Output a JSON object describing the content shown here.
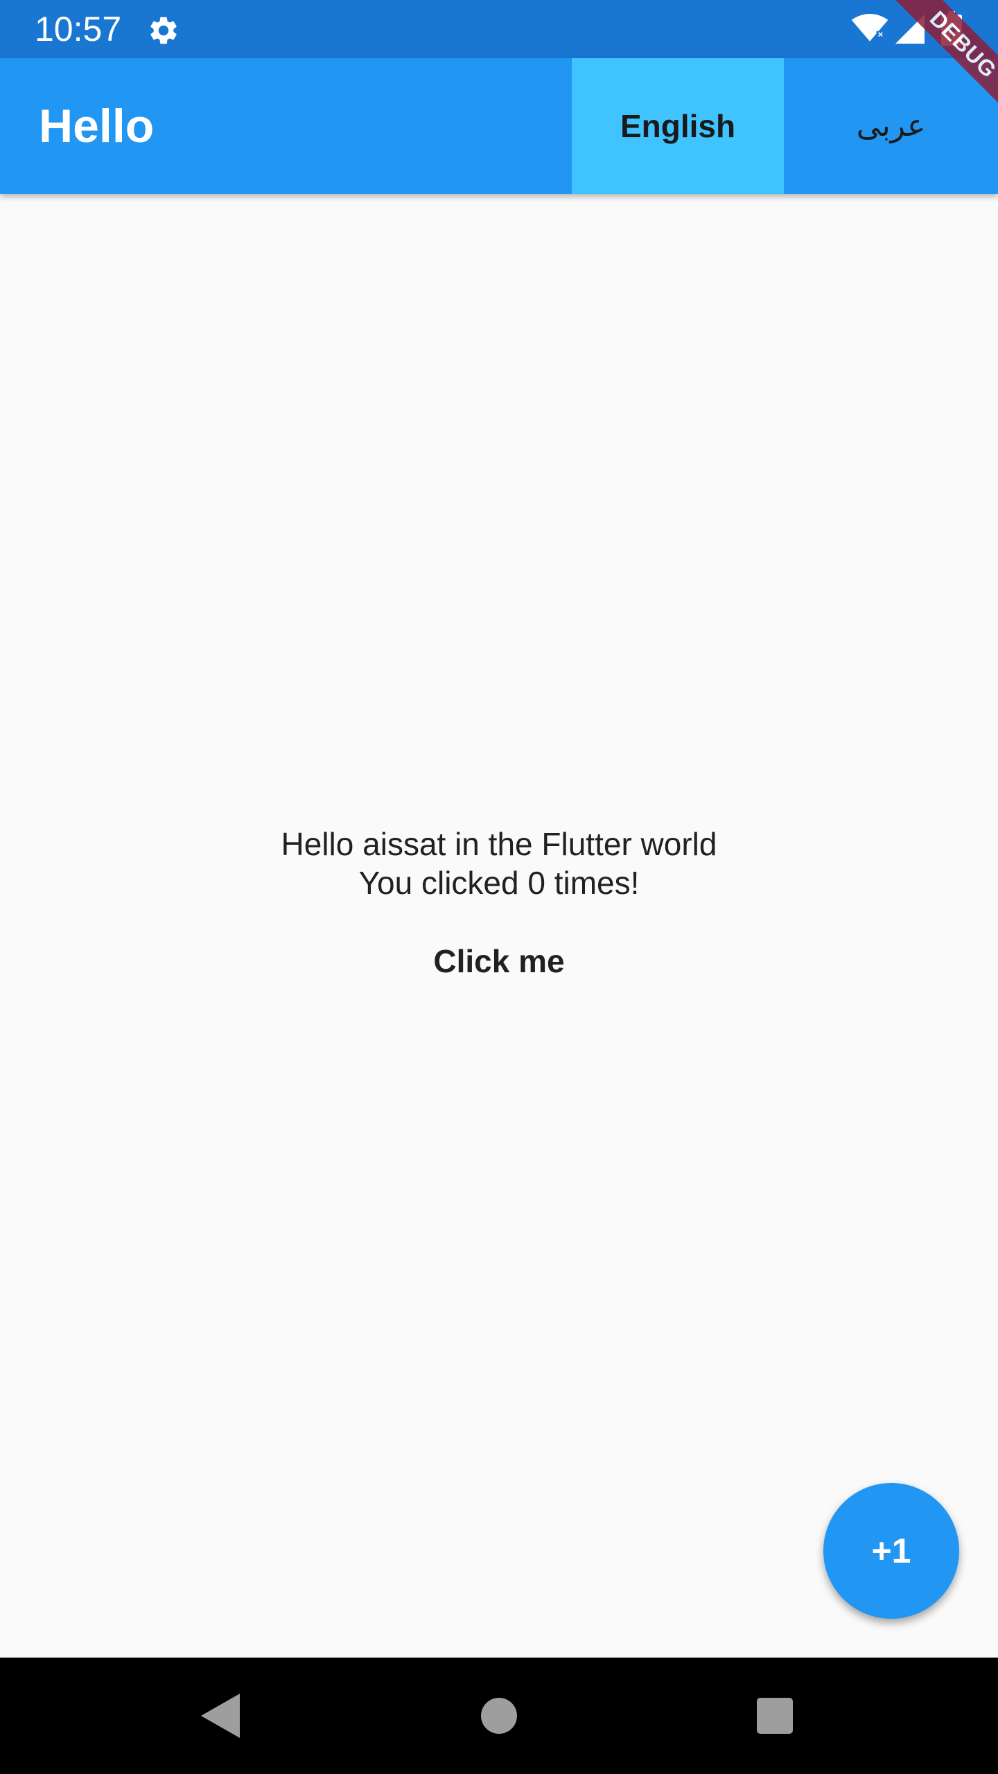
{
  "status_bar": {
    "time": "10:57",
    "icons": [
      "gear-icon",
      "wifi-icon",
      "signal-icon",
      "battery-icon"
    ]
  },
  "app_bar": {
    "title": "Hello",
    "languages": [
      {
        "label": "English",
        "selected": true
      },
      {
        "label": "عربى",
        "selected": false
      }
    ]
  },
  "debug_banner": "DEBUG",
  "main": {
    "greeting": "Hello aissat in the Flutter world",
    "click_count": "You clicked 0 times!",
    "click_button": "Click me"
  },
  "fab": {
    "label": "+1"
  },
  "nav_bar": {
    "icons": [
      "back-icon",
      "home-icon",
      "recents-icon"
    ]
  },
  "colors": {
    "status_bar": "#1976d2",
    "app_bar": "#2196f3",
    "selected_language": "#40c4ff",
    "fab": "#2196f3",
    "debug_banner": "#8b1f3a",
    "background": "#fafafa"
  }
}
